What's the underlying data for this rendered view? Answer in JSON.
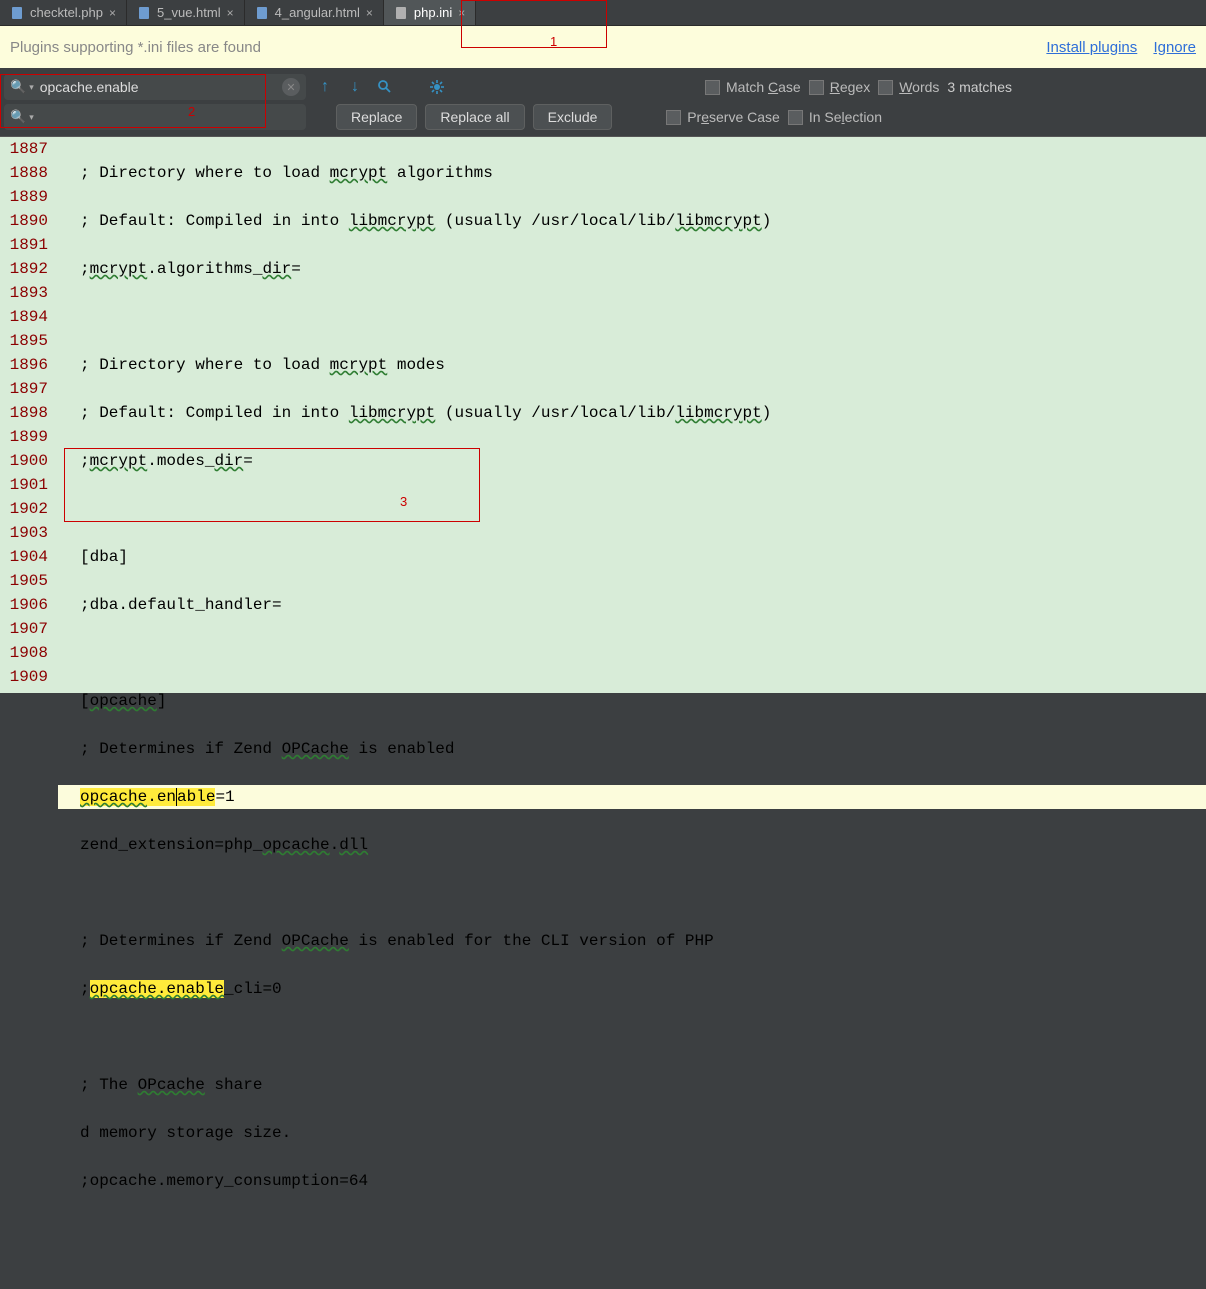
{
  "tabs": [
    {
      "label": "checktel.php",
      "active": false
    },
    {
      "label": "5_vue.html",
      "active": false
    },
    {
      "label": "4_angular.html",
      "active": false
    },
    {
      "label": "php.ini",
      "active": true
    }
  ],
  "notify": {
    "message": "Plugins supporting *.ini files are found",
    "install": "Install plugins",
    "ignore": "Ignore"
  },
  "search": {
    "value": "opcache.enable",
    "replace_value": "",
    "replace": "Replace",
    "replace_all": "Replace all",
    "exclude": "Exclude",
    "match_case_pre": "Match ",
    "match_case_u": "C",
    "match_case_post": "ase",
    "regex_u": "R",
    "regex_post": "egex",
    "words_u": "W",
    "words_post": "ords",
    "preserve_pre": "Pr",
    "preserve_u": "e",
    "preserve_post": "serve Case",
    "in_sel_pre": "In Se",
    "in_sel_u": "l",
    "in_sel_post": "ection",
    "matches": "3 matches"
  },
  "gutter": [
    "1887",
    "1888",
    "1889",
    "1890",
    "1891",
    "1892",
    "1893",
    "1894",
    "1895",
    "1896",
    "1897",
    "1898",
    "1899",
    "1900",
    "1901",
    "1902",
    "1903",
    "1904",
    "1905",
    "1906",
    "1907",
    "1908",
    "1909"
  ],
  "code": {
    "l1887_a": "; Directory where to load ",
    "l1887_b": "mcrypt",
    "l1887_c": " algorithms",
    "l1888_a": "; Default: Compiled in into ",
    "l1888_b": "libmcrypt",
    "l1888_c": " (usually /usr/local/lib/",
    "l1888_d": "libmcrypt",
    "l1888_e": ")",
    "l1889_a": ";",
    "l1889_b": "mcrypt",
    "l1889_c": ".algorithms_",
    "l1889_d": "dir",
    "l1889_e": "=",
    "l1891_a": "; Directory where to load ",
    "l1891_b": "mcrypt",
    "l1891_c": " modes",
    "l1892_a": "; Default: Compiled in into ",
    "l1892_b": "libmcrypt",
    "l1892_c": " (usually /usr/local/lib/",
    "l1892_d": "libmcrypt",
    "l1892_e": ")",
    "l1893_a": ";",
    "l1893_b": "mcrypt",
    "l1893_c": ".modes_",
    "l1893_d": "dir",
    "l1893_e": "=",
    "l1895": "[dba]",
    "l1896": ";dba.default_handler=",
    "l1898_a": "[",
    "l1898_b": "opcache",
    "l1898_c": "]",
    "l1899_a": "; Determines if Zend ",
    "l1899_b": "OPCache",
    "l1899_c": " is enabled",
    "l1900_hl1": "opcache",
    "l1900_dot": ".en",
    "l1900_hl2": "able",
    "l1900_eq": "=1",
    "l1901_a": "zend_extension=php_",
    "l1901_b": "opcache",
    "l1901_c": ".",
    "l1901_d": "dll",
    "l1903_a": "; Determines if Zend ",
    "l1903_b": "OPCache",
    "l1903_c": " is enabled for the CLI version of PHP",
    "l1904_a": ";",
    "l1904_hl": "opcache.enable",
    "l1904_b": "_cli=0",
    "l1906_a": "; The ",
    "l1906_b": "OPcache",
    "l1906_c": " share",
    "l1907": "d memory storage size.",
    "l1908": ";opcache.memory_consumption=64"
  },
  "annot": {
    "l1": "1",
    "l2": "2",
    "l3": "3"
  }
}
